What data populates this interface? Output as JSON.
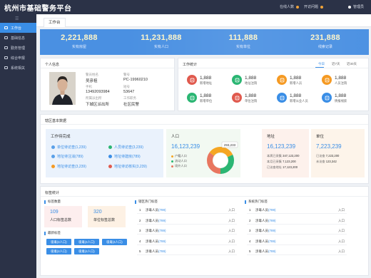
{
  "app": {
    "title": "杭州市基础警务平台"
  },
  "topbar": {
    "online_label": "在线人数",
    "tasks_label": "开访问题",
    "admin_label": "管理员"
  },
  "sidebar": {
    "toggle": "☰",
    "items": [
      {
        "label": "工作台"
      },
      {
        "label": "基础信息"
      },
      {
        "label": "勤务管理"
      },
      {
        "label": "综合申报"
      },
      {
        "label": "系统相关"
      }
    ]
  },
  "tabs": [
    {
      "label": "工作台"
    }
  ],
  "stats": [
    {
      "value": "2,221,888",
      "label": "实有房屋"
    },
    {
      "value": "11,231,888",
      "label": "实有人口"
    },
    {
      "value": "111,888",
      "label": "实有单位"
    },
    {
      "value": "231,888",
      "label": "线索记录"
    }
  ],
  "personal": {
    "title": "个人信息",
    "fields": [
      {
        "label": "警员姓名",
        "value": "吴彦祖"
      },
      {
        "label": "警号",
        "value": "PC-19960210"
      },
      {
        "label": "手机",
        "value": "13492093984"
      },
      {
        "label": "短号",
        "value": "53647"
      },
      {
        "label": "所属派出所",
        "value": "下城区派出所"
      },
      {
        "label": "工作职务",
        "value": "社区民警"
      }
    ]
  },
  "work_stats": {
    "title": "工作统计",
    "periods": [
      "今日",
      "近7天",
      "近30天"
    ],
    "items": [
      {
        "value": "1,888",
        "label": "新增地址",
        "color": "#e05a4e",
        "icon": "home-icon"
      },
      {
        "value": "1,888",
        "label": "地址注销",
        "color": "#2bb673",
        "icon": "home-remove-icon"
      },
      {
        "value": "1,888",
        "label": "新增人员",
        "color": "#f59a23",
        "icon": "person-add-icon"
      },
      {
        "value": "1,888",
        "label": "人员注销",
        "color": "#f59a23",
        "icon": "person-remove-icon"
      },
      {
        "value": "1,888",
        "label": "新增单位",
        "color": "#2bb673",
        "icon": "building-icon"
      },
      {
        "value": "1,888",
        "label": "单位注销",
        "color": "#e05a4e",
        "icon": "building-remove-icon"
      },
      {
        "value": "1,888",
        "label": "新增从业人员",
        "color": "#3a8ee6",
        "icon": "worker-icon"
      },
      {
        "value": "1,888",
        "label": "情报线索",
        "color": "#3a8ee6",
        "icon": "clue-icon"
      }
    ]
  },
  "jurisdiction": {
    "title": "辖区基本数据",
    "tasks_title": "工作待完成",
    "tasks": [
      {
        "label": "单位待访查",
        "count": "(1,239)",
        "color": "#5aa0e8"
      },
      {
        "label": "人员待访查",
        "count": "(3,239)",
        "color": "#2bb673"
      },
      {
        "label": "地址待注消",
        "count": "(789)",
        "color": "#5aa0e8"
      },
      {
        "label": "地址待建房",
        "count": "(789)",
        "color": "#3a8ee6"
      },
      {
        "label": "地址待访查",
        "count": "(3,239)",
        "color": "#f59a23"
      },
      {
        "label": "地址待访核实",
        "count": "(3,239)",
        "color": "#e05a4e"
      }
    ],
    "population": {
      "title": "人口",
      "value": "16,123,239",
      "tooltip": "293,233",
      "legend": [
        {
          "label": "户籍人口",
          "color": "#f5a623"
        },
        {
          "label": "流动人口",
          "color": "#2bb673"
        },
        {
          "label": "境外人口",
          "color": "#e8765f"
        }
      ]
    },
    "address": {
      "title": "地址",
      "value": "16,123,239",
      "rows": [
        {
          "label": "本周已采集",
          "value": "347,123,200"
        },
        {
          "label": "本月已采集",
          "value": "7,123,200"
        },
        {
          "label": "已访查地址",
          "value": "17,123,200"
        }
      ]
    },
    "unit": {
      "title": "单位",
      "value": "7,223,239",
      "rows": [
        {
          "label": "已访查",
          "value": "7,223,200"
        },
        {
          "label": "未访查",
          "value": "123,342"
        }
      ]
    }
  },
  "tag_stats": {
    "title": "标签统计",
    "count_title": "标签数量",
    "counts": [
      {
        "value": "109",
        "label": "人口标签总数"
      },
      {
        "value": "320",
        "label": "单位标签总数"
      }
    ],
    "latest_title": "最新标签",
    "latest": [
      "吸毒(4人口)",
      "吸毒(4人口)",
      "吸毒(4人口)",
      "吸毒(4人口)",
      "吸毒(4人口)"
    ],
    "area_title": "辖区热门标签",
    "system_title": "系统热门标签",
    "area_rows": [
      {
        "idx": "1",
        "name": "涉毒人员",
        "count": "(789)",
        "action": "入口"
      },
      {
        "idx": "2",
        "name": "涉毒人员",
        "count": "(789)",
        "action": "入口"
      },
      {
        "idx": "3",
        "name": "涉毒人员",
        "count": "(789)",
        "action": "入口"
      },
      {
        "idx": "4",
        "name": "涉毒人员",
        "count": "(789)",
        "action": "入口"
      },
      {
        "idx": "5",
        "name": "涉毒人员",
        "count": "(789)",
        "action": "入口"
      }
    ],
    "system_rows": [
      {
        "idx": "1",
        "name": "涉毒人员",
        "count": "(789)",
        "action": "入口"
      },
      {
        "idx": "2",
        "name": "涉毒人员",
        "count": "(789)",
        "action": "入口"
      },
      {
        "idx": "3",
        "name": "涉毒人员",
        "count": "(789)",
        "action": "入口"
      },
      {
        "idx": "4",
        "name": "涉毒人员",
        "count": "(789)",
        "action": "入口"
      },
      {
        "idx": "5",
        "name": "涉毒人员",
        "count": "(789)",
        "action": "入口"
      }
    ]
  }
}
